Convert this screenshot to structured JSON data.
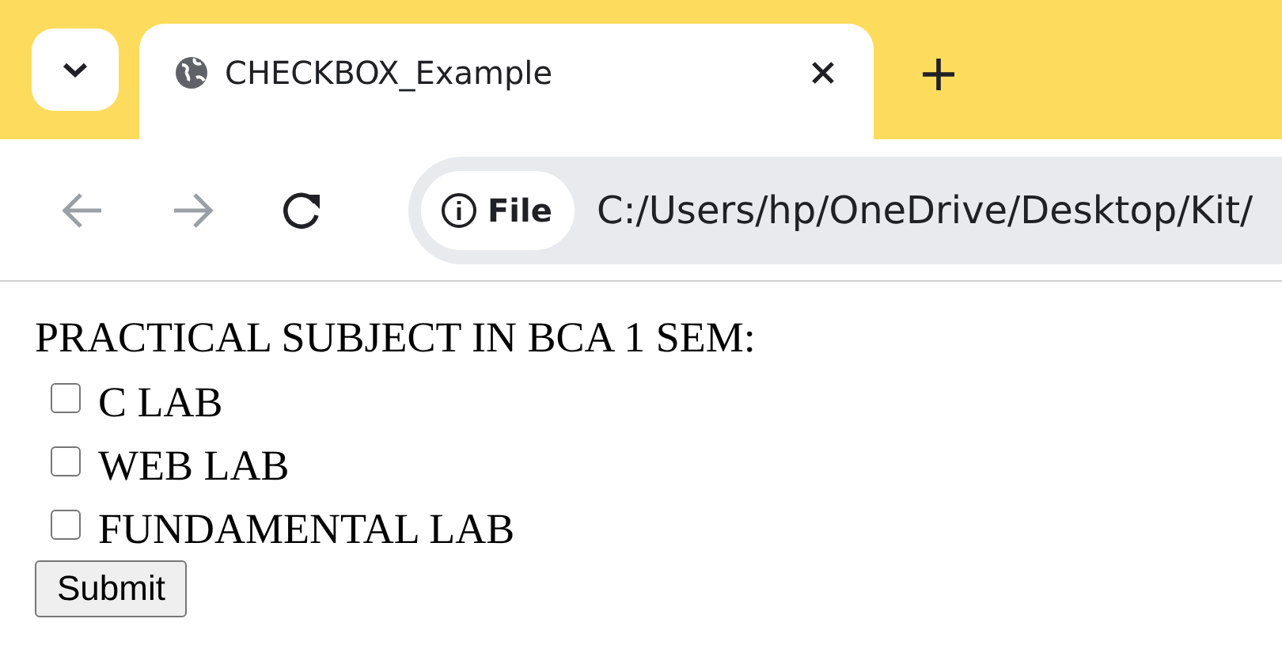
{
  "browser": {
    "tabs": [
      {
        "title": "CHECKBOX_Example",
        "selected": true
      }
    ],
    "navigation": {
      "back_enabled": false,
      "forward_enabled": false
    },
    "address_bar": {
      "scheme_label": "File",
      "url": "C:/Users/hp/OneDrive/Desktop/Kit/"
    }
  },
  "page": {
    "heading": "PRACTICAL SUBJECT IN BCA 1 SEM:",
    "checkboxes": [
      {
        "label": "C LAB",
        "checked": false
      },
      {
        "label": "WEB LAB",
        "checked": false
      },
      {
        "label": "FUNDAMENTAL LAB",
        "checked": false
      }
    ],
    "submit_button": "Submit"
  }
}
